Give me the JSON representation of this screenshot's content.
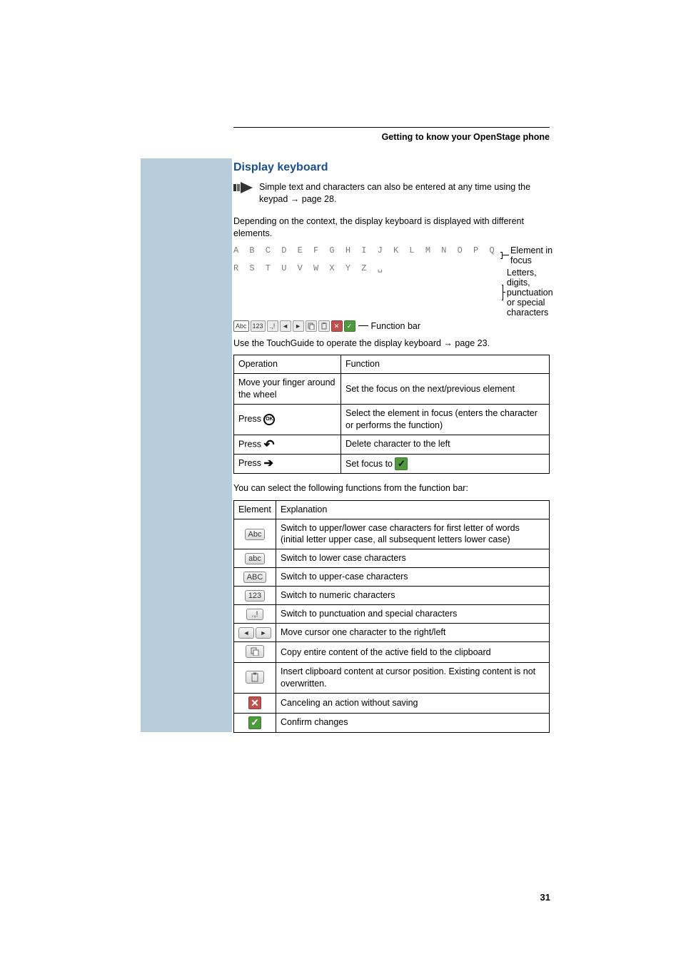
{
  "header": "Getting to know your OpenStage phone",
  "section_title": "Display keyboard",
  "note": "Simple text and characters can also be entered at any time using the keypad ",
  "note_xref": "page 28.",
  "arrow": "→",
  "body1": "Depending on the context, the display keyboard is displayed with different elements.",
  "kb_row1": "A B C D E F G H I J K L M N O P Q",
  "kb_row2": "R S T U V W X Y Z ␣",
  "annot_focus": "Element in focus",
  "annot_letters": "Letters, digits, punctuation or special characters",
  "annot_funcbar": "Function bar",
  "body2_a": "Use the TouchGuide to operate the display keyboard ",
  "body2_b": "page 23.",
  "ops_table": {
    "h1": "Operation",
    "h2": "Function",
    "r1c1": "Move your finger around the wheel",
    "r1c2": "Set the focus on the next/previous element",
    "r2c1": "Press ",
    "r2c2": "Select the element in focus (enters the character or performs the function)",
    "r3c1": "Press ",
    "r3c2": "Delete character to the left",
    "r4c1": "Press ",
    "r4c2": "Set focus to "
  },
  "body3": "You can select the following functions from the function bar:",
  "elems_table": {
    "h1": "Element",
    "h2": "Explanation",
    "r1": "Switch to upper/lower case characters for first letter of words (initial letter upper case, all subsequent letters lower case)",
    "r2": "Switch to lower case characters",
    "r3": "Switch to upper-case characters",
    "r4": "Switch to numeric characters",
    "r5": "Switch to punctuation and special characters",
    "r6": "Move cursor one character to the right/left",
    "r7": "Copy entire content of the active field to the clipboard",
    "r8": "Insert clipboard content at cursor position. Existing content is not overwritten.",
    "r9": "Canceling an action without saving",
    "r10": "Confirm changes",
    "labels": {
      "abc_mixed": "Abc",
      "abc_lower": "abc",
      "abc_upper": "ABC",
      "num": "123",
      "punct": ".,!"
    }
  },
  "page_number": "31",
  "funcbar_items": {
    "abc": "Abc",
    "num": "123",
    "punct": ".,!"
  }
}
